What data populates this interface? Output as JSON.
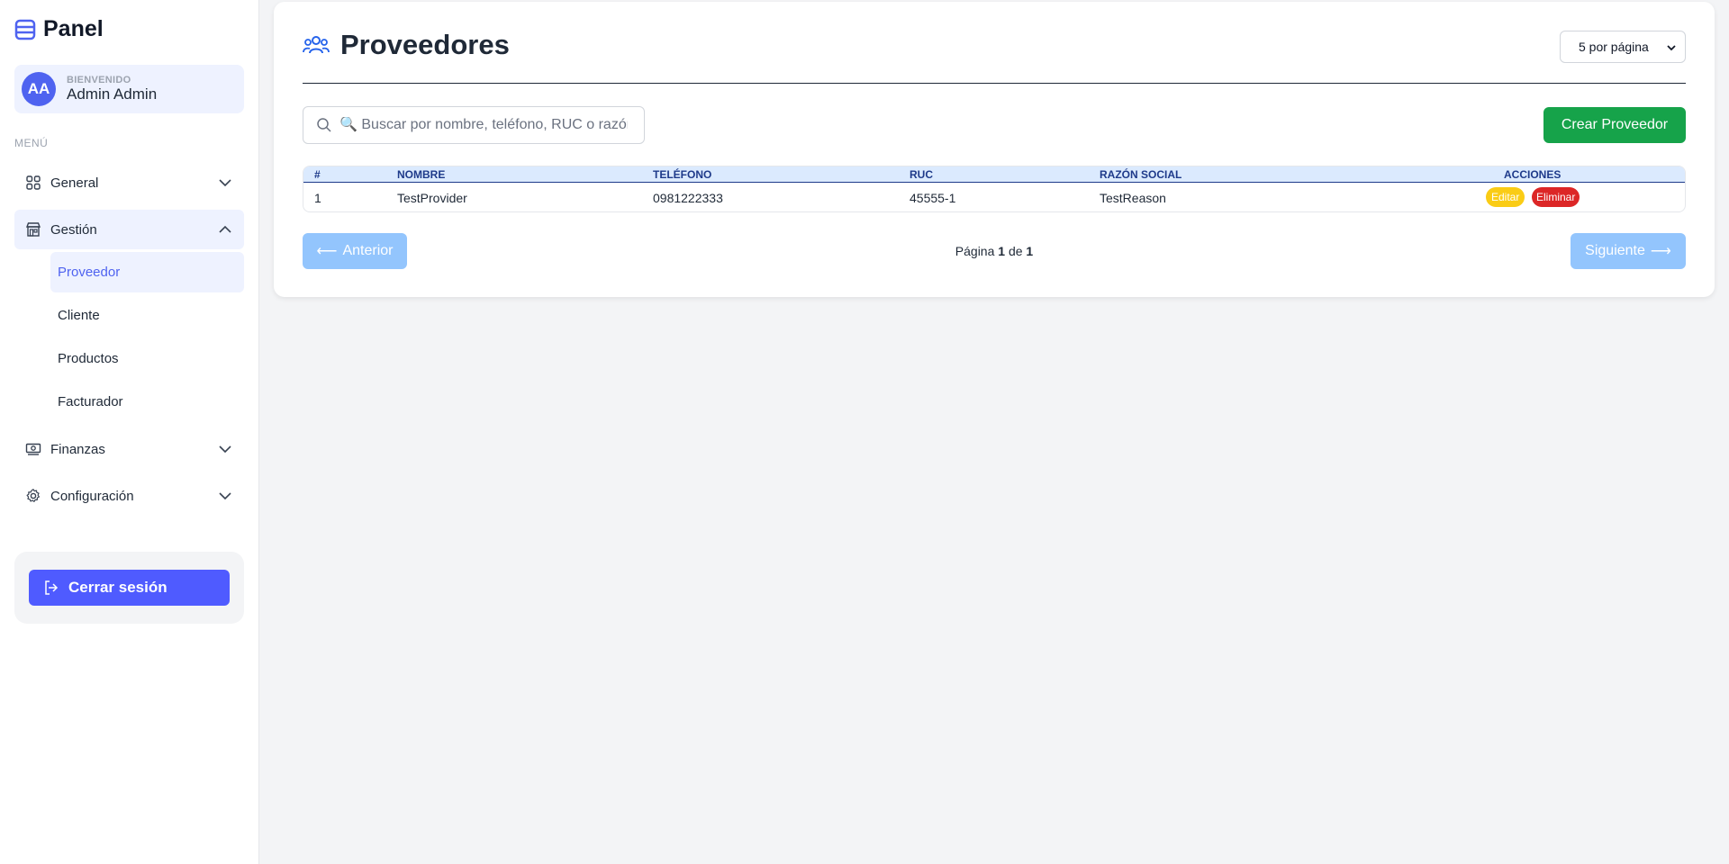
{
  "brand": {
    "title": "Panel",
    "icon": "database-icon"
  },
  "user": {
    "initials": "AA",
    "welcome": "BIENVENIDO",
    "name": "Admin Admin"
  },
  "menu": {
    "label": "MENÚ",
    "items": [
      {
        "label": "General",
        "icon": "grid-icon",
        "expanded": false
      },
      {
        "label": "Gestión",
        "icon": "store-icon",
        "expanded": true,
        "children": [
          "Proveedor",
          "Cliente",
          "Productos",
          "Facturador"
        ],
        "active_child": "Proveedor"
      },
      {
        "label": "Finanzas",
        "icon": "money-icon",
        "expanded": false
      },
      {
        "label": "Configuración",
        "icon": "gear-icon",
        "expanded": false
      }
    ]
  },
  "logout": {
    "label": "Cerrar sesión"
  },
  "page": {
    "title": "Proveedores",
    "per_page": "5 por página",
    "search_placeholder": "🔍 Buscar por nombre, teléfono, RUC o razón social",
    "create_label": "Crear Proveedor"
  },
  "table": {
    "headers": [
      "#",
      "NOMBRE",
      "TELÉFONO",
      "RUC",
      "RAZÓN SOCIAL",
      "ACCIONES"
    ],
    "rows": [
      {
        "num": "1",
        "name": "TestProvider",
        "phone": "0981222333",
        "ruc": "45555-1",
        "reason": "TestReason"
      }
    ],
    "edit_label": "Editar",
    "delete_label": "Eliminar"
  },
  "pager": {
    "prev": "Anterior",
    "next": "Siguiente",
    "page_word": "Página",
    "of_word": "de",
    "current": "1",
    "total": "1"
  },
  "colors": {
    "accent": "#4f63f0",
    "create": "#16a34a",
    "edit": "#facc15",
    "delete": "#dc2626",
    "pager": "#93c5fd"
  }
}
